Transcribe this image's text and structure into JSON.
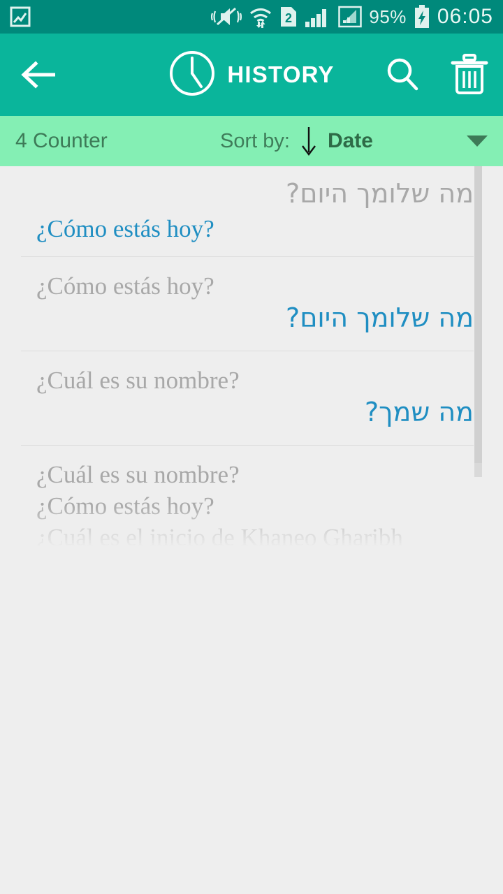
{
  "status_bar": {
    "background": "#00897b",
    "icons": [
      "photo-icon",
      "vibrate-mute-icon",
      "wifi-icon",
      "sim2-icon",
      "signal-icon",
      "signal-data-icon"
    ],
    "battery_percent": "95%",
    "battery_state": "charging",
    "time": "06:05"
  },
  "app_bar": {
    "background": "#0ab59b",
    "back_label": "Back",
    "clock_icon": "clock-icon",
    "title": "HISTORY",
    "search_label": "Search",
    "delete_label": "Delete all"
  },
  "sort_bar": {
    "background": "#84efb4",
    "counter": "4 Counter",
    "sort_by_label": "Sort by:",
    "sort_direction": "descending",
    "sort_value": "Date",
    "dropdown_icon": "chevron-down-icon"
  },
  "list": {
    "accent": "#1f8ec2",
    "muted": "#a8a8a8",
    "items": [
      {
        "line1": "מה שלומך היום?",
        "line1_lang": "he",
        "line1_style": "muted",
        "line1_align": "right",
        "line2": "¿Cómo estás hoy?",
        "line2_lang": "es",
        "line2_style": "accent",
        "line2_align": "left"
      },
      {
        "line1": "¿Cómo estás hoy?",
        "line1_lang": "es",
        "line1_style": "muted",
        "line1_align": "left",
        "line2": "מה שלומך היום?",
        "line2_lang": "he",
        "line2_style": "accent",
        "line2_align": "right"
      },
      {
        "line1": "¿Cuál es su nombre?",
        "line1_lang": "es",
        "line1_style": "muted",
        "line1_align": "left",
        "line2": "מה שמך?",
        "line2_lang": "he",
        "line2_style": "accent",
        "line2_align": "right"
      },
      {
        "line1": "¿Cuál es su nombre?",
        "line1_lang": "es",
        "line1_style": "muted",
        "line1_align": "left",
        "line2": "¿Cómo estás hoy?",
        "line2_lang": "es",
        "line2_style": "muted",
        "line2_align": "left",
        "line3": "¿Cuál es el inicio de Khaneo Gharibh",
        "line3_lang": "es",
        "line3_style": "muted",
        "line3_align": "left"
      }
    ]
  }
}
